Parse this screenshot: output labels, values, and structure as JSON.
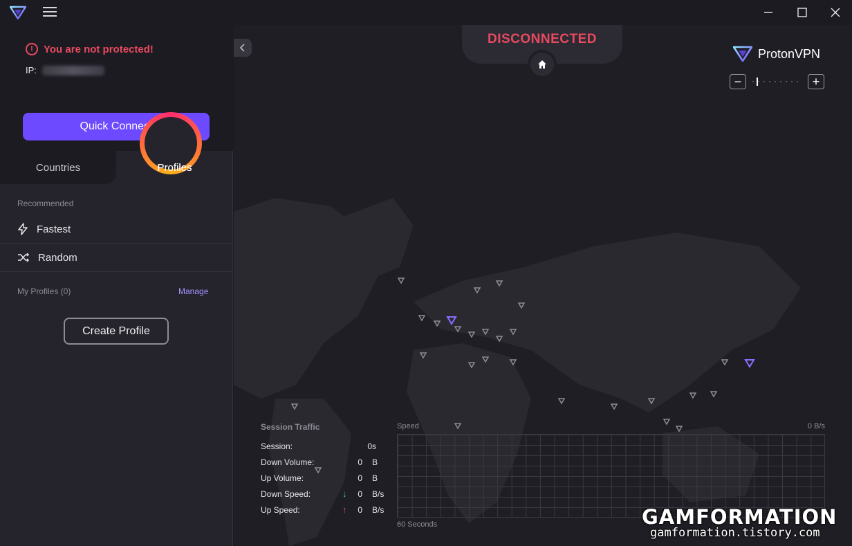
{
  "window": {
    "controls": [
      "minimize-icon",
      "maximize-icon",
      "close-icon"
    ]
  },
  "sidebar": {
    "warning": "You are not protected!",
    "ip_label": "IP:",
    "quick_connect": "Quick Connect",
    "tabs": [
      {
        "label": "Countries",
        "active": false
      },
      {
        "label": "Profiles",
        "active": true
      }
    ],
    "recommended_label": "Recommended",
    "recommended_items": [
      {
        "label": "Fastest",
        "icon": "lightning-icon"
      },
      {
        "label": "Random",
        "icon": "shuffle-icon"
      }
    ],
    "my_profiles_label": "My Profiles (0)",
    "manage_label": "Manage",
    "create_profile": "Create Profile"
  },
  "map": {
    "status": "DISCONNECTED",
    "brand_name": "Proton",
    "brand_suffix": "VPN",
    "zoom_out": "−",
    "zoom_in": "+"
  },
  "traffic": {
    "title": "Session Traffic",
    "rows": [
      {
        "label": "Session:",
        "value": "0s",
        "unit": ""
      },
      {
        "label": "Down Volume:",
        "value": "0",
        "unit": "B"
      },
      {
        "label": "Up Volume:",
        "value": "0",
        "unit": "B"
      },
      {
        "label": "Down Speed:",
        "value": "0",
        "unit": "B/s",
        "arrow": "↓"
      },
      {
        "label": "Up Speed:",
        "value": "0",
        "unit": "B/s",
        "arrow": "↑"
      }
    ],
    "speed_label": "Speed",
    "speed_value": "0 B/s",
    "seconds_label": "60 Seconds"
  },
  "watermark": {
    "title": "GAMFORMATION",
    "url": "gamformation.tistory.com"
  },
  "colors": {
    "accent": "#6d4aff",
    "danger": "#e84a5f",
    "down_arrow": "#3fbfa0",
    "up_arrow": "#e84a5f"
  }
}
